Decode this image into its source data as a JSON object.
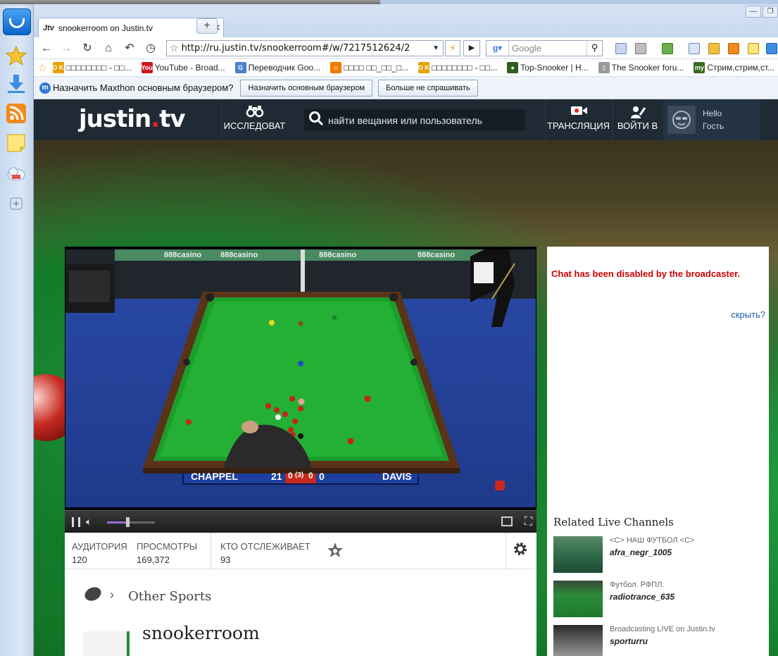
{
  "browser": {
    "tab_title": "snookerroom on Justin.tv",
    "tab_favicon_text": "Jtv",
    "new_tab": "+",
    "url": "http://ru.justin.tv/snookerroom#/w/7217512624/2",
    "search_engine": "Google",
    "search_placeholder": "Google"
  },
  "bookmarks": [
    {
      "label": "□□□□□□□□ - □□...",
      "icon": "SO KU",
      "color": "#e8a000"
    },
    {
      "label": "YouTube - Broad...",
      "icon": "You",
      "color": "#cc181e"
    },
    {
      "label": "Переводчик Goo...",
      "icon": "G",
      "color": "#4a7fd0"
    },
    {
      "label": "□□□□ □□_□□_□...",
      "icon": "☺",
      "color": "#f07a00"
    },
    {
      "label": "□□□□□□□□ - □□...",
      "icon": "SO KU",
      "color": "#e8a000"
    },
    {
      "label": "Top-Snooker | H...",
      "icon": "●",
      "color": "#2e5e1e"
    },
    {
      "label": "The Snooker foru...",
      "icon": "▯",
      "color": "#999999"
    },
    {
      "label": "Стрим,стрим,ст...",
      "icon": "my",
      "color": "#3a6a20"
    }
  ],
  "notification": {
    "message": "Назначить Maxthon основным браузером?",
    "primary_button": "Назначить основным браузером",
    "secondary_button": "Больше не спрашивать"
  },
  "site": {
    "logo_main": "justin",
    "logo_dot": ".",
    "logo_tld": "tv",
    "explore": "ИССЛЕДОВАТ",
    "search_placeholder": "найти вещания или пользователь",
    "broadcast": "ТРАНСЛЯЦИЯ",
    "login": "ВОЙТИ В",
    "hello": "Hello",
    "guest": "Гость"
  },
  "video": {
    "scoreboard": {
      "player1": "CHAPPEL",
      "score1": "21",
      "frames1": "0",
      "best_of": "(3)",
      "frames2": "0",
      "score2": "0",
      "player2": "DAVIS"
    },
    "sponsor": "888casino",
    "volume_fraction": 0.4
  },
  "stats": {
    "audience_label": "АУДИТОРИЯ",
    "audience_value": "120",
    "views_label": "ПРОСМОТРЫ",
    "views_value": "169,372",
    "followers_label": "КТО ОТСЛЕЖИВАЕТ",
    "followers_value": "93"
  },
  "channel": {
    "category": "Other Sports",
    "name": "snookerroom"
  },
  "chat": {
    "disabled_message": "Chat has been disabled by the broadcaster.",
    "hide_link": "скрыть?",
    "related_title": "Related Live Channels",
    "related": [
      {
        "title": "<С> НАШ ФУТБОЛ <С>",
        "user": "afra_negr_1005"
      },
      {
        "title": "Футбол. РФПЛ.",
        "user": "radiotrance_635"
      },
      {
        "title": "Broadcasting LIVE on Justin.tv",
        "user": "sporturru"
      }
    ]
  },
  "colors": {
    "header_bg": "#1f2a35",
    "accent_red": "#e02424",
    "chat_disabled": "#cc0000",
    "link_blue": "#1b5ba6",
    "table_green": "#1a9a2a"
  }
}
